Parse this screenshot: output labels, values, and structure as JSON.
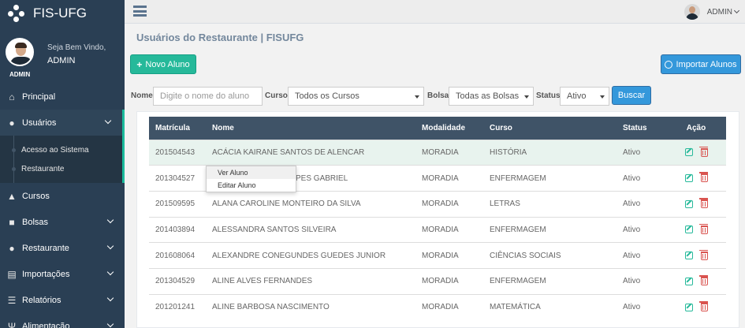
{
  "brand": {
    "name": "FIS-UFG"
  },
  "profile": {
    "welcome": "Seja Bem Vindo,",
    "name": "ADMIN",
    "caption": "ADMIN"
  },
  "topnav": {
    "user": "ADMIN"
  },
  "sidebar": {
    "items": [
      {
        "label": "Principal",
        "icon": "home-icon"
      },
      {
        "label": "Usuários",
        "icon": "user-icon"
      },
      {
        "label": "Cursos",
        "icon": "graduation-cap-icon"
      },
      {
        "label": "Bolsas",
        "icon": "briefcase-icon"
      },
      {
        "label": "Restaurante",
        "icon": "user-icon"
      },
      {
        "label": "Importações",
        "icon": "file-import-icon"
      },
      {
        "label": "Relatórios",
        "icon": "list-icon"
      },
      {
        "label": "Alimentação",
        "icon": "cutlery-icon"
      }
    ],
    "usuarios_sub": [
      {
        "label": "Acesso ao Sistema"
      },
      {
        "label": "Restaurante"
      }
    ]
  },
  "page": {
    "title": "Usuários do Restaurante | FISUFG"
  },
  "buttons": {
    "novo": "Novo Aluno",
    "importar": "Importar Alunos",
    "buscar": "Buscar"
  },
  "filters": {
    "nome_label": "Nome",
    "nome_placeholder": "Digite o nome do aluno",
    "curso_label": "Curso",
    "curso_value": "Todos os Cursos",
    "bolsa_label": "Bolsa",
    "bolsa_value": "Todas as Bolsas",
    "status_label": "Status",
    "status_value": "Ativo"
  },
  "table": {
    "headers": {
      "matricula": "Matrícula",
      "nome": "Nome",
      "modalidade": "Modalidade",
      "curso": "Curso",
      "status": "Status",
      "acao": "Ação"
    },
    "rows": [
      {
        "matricula": "201504543",
        "nome": "ACÁCIA KAIRANE SANTOS DE ALENCAR",
        "modalidade": "MORADIA",
        "curso": "HISTÓRIA",
        "status": "Ativo"
      },
      {
        "matricula": "201304527",
        "nome": "PES GABRIEL",
        "modalidade": "MORADIA",
        "curso": "ENFERMAGEM",
        "status": "Ativo"
      },
      {
        "matricula": "201509595",
        "nome": "ALANA CAROLINE MONTEIRO DA SILVA",
        "modalidade": "MORADIA",
        "curso": "LETRAS",
        "status": "Ativo"
      },
      {
        "matricula": "201403894",
        "nome": "ALESSANDRA SANTOS SILVEIRA",
        "modalidade": "MORADIA",
        "curso": "ENFERMAGEM",
        "status": "Ativo"
      },
      {
        "matricula": "201608064",
        "nome": "ALEXANDRE CONEGUNDES GUEDES JUNIOR",
        "modalidade": "MORADIA",
        "curso": "CIÊNCIAS SOCIAIS",
        "status": "Ativo"
      },
      {
        "matricula": "201304529",
        "nome": "ALINE ALVES FERNANDES",
        "modalidade": "MORADIA",
        "curso": "ENFERMAGEM",
        "status": "Ativo"
      },
      {
        "matricula": "201201241",
        "nome": "ALINE BARBOSA NASCIMENTO",
        "modalidade": "MORADIA",
        "curso": "MATEMÁTICA",
        "status": "Ativo"
      }
    ]
  },
  "context_menu": {
    "items": [
      "Ver Aluno",
      "Editar Aluno"
    ]
  },
  "colors": {
    "sidebar": "#2a3f54",
    "accent": "#1abb9c",
    "success": "#26b99a",
    "primary": "#3498db",
    "danger": "#d9534f",
    "table_header": "#3f5367"
  }
}
